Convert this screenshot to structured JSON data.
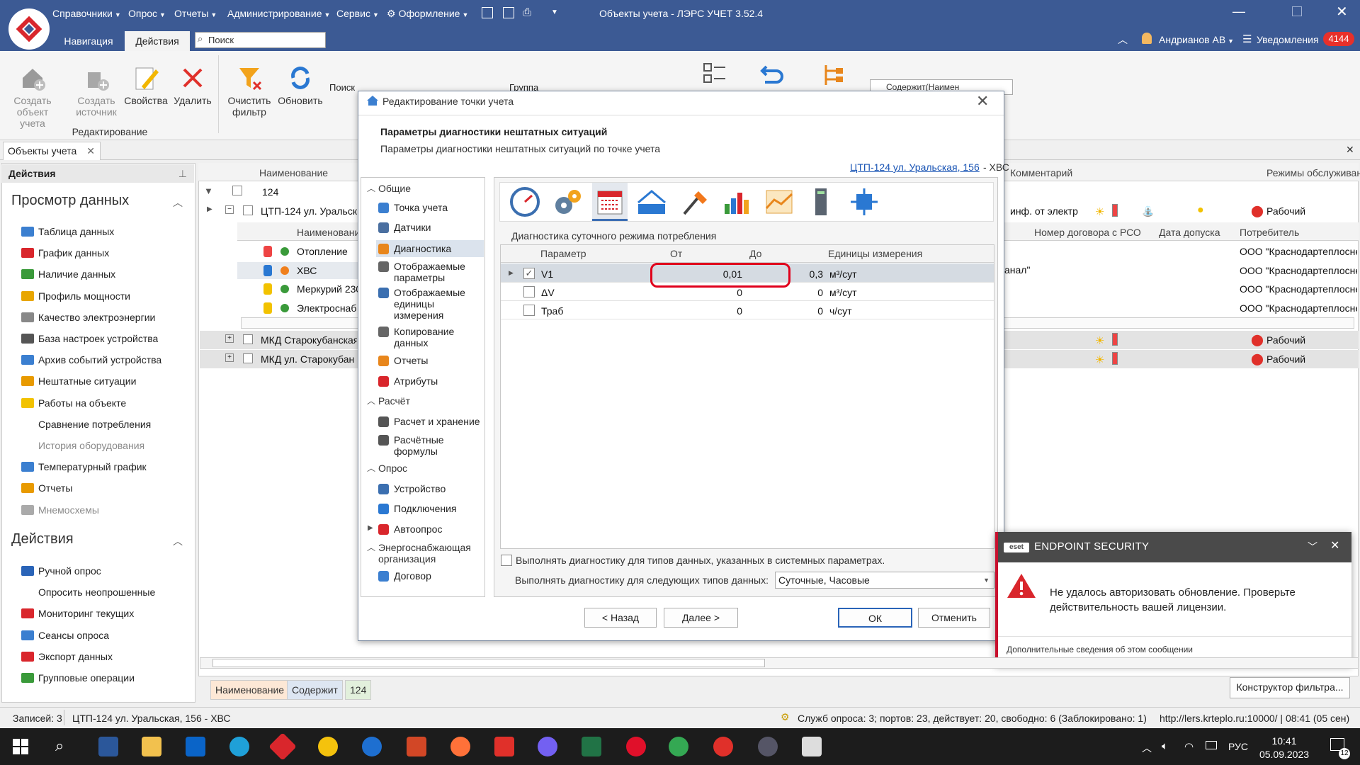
{
  "window": {
    "title": "Объекты учета - ЛЭРС УЧЕТ 3.52.4",
    "menu": [
      "Справочники",
      "Опрос",
      "Отчеты",
      "Администрирование",
      "Сервис",
      "Оформление"
    ],
    "tabs": [
      "Навигация",
      "Действия"
    ],
    "search_placeholder": "Поиск",
    "user": "Андрианов АВ",
    "notifications_label": "Уведомления",
    "notifications_count": "4144"
  },
  "ribbon": {
    "buttons": [
      {
        "label": "Создать объект учета",
        "icon": "house-add-icon"
      },
      {
        "label": "Создать источник",
        "icon": "source-add-icon"
      },
      {
        "label": "Свойства",
        "icon": "edit-pencil-icon"
      },
      {
        "label": "Удалить",
        "icon": "delete-x-icon"
      },
      {
        "label": "Очистить фильтр",
        "icon": "clear-filter-icon"
      },
      {
        "label": "Обновить",
        "icon": "refresh-icon"
      }
    ],
    "group_label": "Редактирование",
    "search_label": "Поиск",
    "group_field_label": "Группа",
    "filter_combo": "Содержит(Наимен"
  },
  "doc_tab": "Объекты учета",
  "left_panel": {
    "header": "Действия",
    "section_view": "Просмотр данных",
    "view_items": [
      {
        "label": "Таблица данных",
        "color": "#3b7fd0"
      },
      {
        "label": "График данных",
        "color": "#d9262c"
      },
      {
        "label": "Наличие данных",
        "color": "#3a9a3a"
      },
      {
        "label": "Профиль мощности",
        "color": "#e8a600"
      },
      {
        "label": "Качество электроэнергии",
        "color": "#888888"
      },
      {
        "label": "База настроек устройства",
        "color": "#555555"
      },
      {
        "label": "Архив событий устройства",
        "color": "#3b7fd0"
      },
      {
        "label": "Нештатные ситуации",
        "color": "#e89a00"
      },
      {
        "label": "Работы на объекте",
        "color": "#f2c200"
      },
      {
        "label": "Сравнение потребления",
        "color": ""
      },
      {
        "label": "История оборудования",
        "color": ""
      },
      {
        "label": "Температурный график",
        "color": "#3b7fd0"
      },
      {
        "label": "Отчеты",
        "color": "#e89a00"
      },
      {
        "label": "Мнемосхемы",
        "color": "#aaaaaa"
      }
    ],
    "section_actions": "Действия",
    "action_items": [
      {
        "label": "Ручной опрос",
        "color": "#2a64b8"
      },
      {
        "label": "Опросить неопрошенные",
        "color": ""
      },
      {
        "label": "Мониторинг текущих",
        "color": "#d9262c"
      },
      {
        "label": "Сеансы опроса",
        "color": "#3b7fd0"
      },
      {
        "label": "Экспорт данных",
        "color": "#d9262c"
      },
      {
        "label": "Групповые операции",
        "color": "#3a9a3a"
      }
    ]
  },
  "grid": {
    "col_name": "Наименование",
    "col_comment": "Комментарий",
    "col_modes": "Режимы обслуживан",
    "filter_value": "124",
    "main_row": "ЦТП-124 ул. Уральска",
    "main_row_comment": "инф. от электр",
    "status": "Рабочий",
    "sub_header": "Наименовани",
    "sub_rows": [
      "Отопление",
      "ХВС",
      "Меркурий 230",
      "Электроснаб"
    ],
    "sub_cols": [
      "Номер договора с РСО",
      "Дата допуска",
      "Потребитель"
    ],
    "consumer": "ООО \"Краснодартеплосне",
    "sub_row_fragment": "анал\"",
    "other_rows": [
      "МКД Старокубанская",
      "МКД ул. Старокубан"
    ]
  },
  "dialog": {
    "title": "Редактирование точки учета",
    "heading": "Параметры диагностики нештатных ситуаций",
    "subheading": "Параметры диагностики нештатных ситуаций по точке учета",
    "link": "ЦТП-124 ул. Уральская, 156",
    "link_suffix": "- ХВС",
    "tree": {
      "groups": [
        "Общие",
        "Расчёт",
        "Опрос",
        "Энергоснабжающая организация"
      ],
      "general": [
        "Точка учета",
        "Датчики",
        "Диагностика",
        "Отображаемые параметры",
        "Отображаемые единицы измерения",
        "Копирование данных",
        "Отчеты",
        "Атрибуты"
      ],
      "calc": [
        "Расчет и хранение",
        "Расчётные формулы"
      ],
      "poll": [
        "Устройство",
        "Подключения",
        "Автоопрос"
      ],
      "org": [
        "Договор"
      ]
    },
    "section_title": "Диагностика суточного режима потребления",
    "table": {
      "headers": [
        "Параметр",
        "От",
        "До",
        "Единицы измерения"
      ],
      "rows": [
        {
          "checked": true,
          "param": "V1",
          "from": "0,01",
          "to": "0,3",
          "unit": "м³/сут"
        },
        {
          "checked": false,
          "param": "ΔV",
          "from": "0",
          "to": "0",
          "unit": "м³/сут"
        },
        {
          "checked": false,
          "param": "Траб",
          "from": "0",
          "to": "0",
          "unit": "ч/сут"
        }
      ]
    },
    "checkbox_system": "Выполнять диагностику для типов данных, указанных в системных параметрах.",
    "types_label": "Выполнять диагностику для следующих типов данных:",
    "types_value": "Суточные, Часовые",
    "buttons": {
      "back": "< Назад",
      "next": "Далее >",
      "ok": "ОК",
      "cancel": "Отменить"
    }
  },
  "eset": {
    "logo": "eset",
    "name": "ENDPOINT SECURITY",
    "message": "Не удалось авторизовать обновление. Проверьте действительность вашей лицензии.",
    "footer": "Дополнительные сведения об этом сообщении"
  },
  "filter_bar": {
    "pills": [
      "Наименование",
      "Содержит",
      "124"
    ],
    "constructor": "Конструктор фильтра..."
  },
  "status": {
    "records": "Записей: 3",
    "current": "ЦТП-124 ул. Уральская, 156 - ХВС",
    "service": "Служб опроса: 3; портов: 23, действует: 20, свободно: 6 (Заблокировано: 1)",
    "server": "http://lers.krteplo.ru:10000/ | 08:41 (05 сен)"
  },
  "taskbar": {
    "lang": "РУС",
    "time": "10:41",
    "date": "05.09.2023",
    "notif": "12"
  }
}
